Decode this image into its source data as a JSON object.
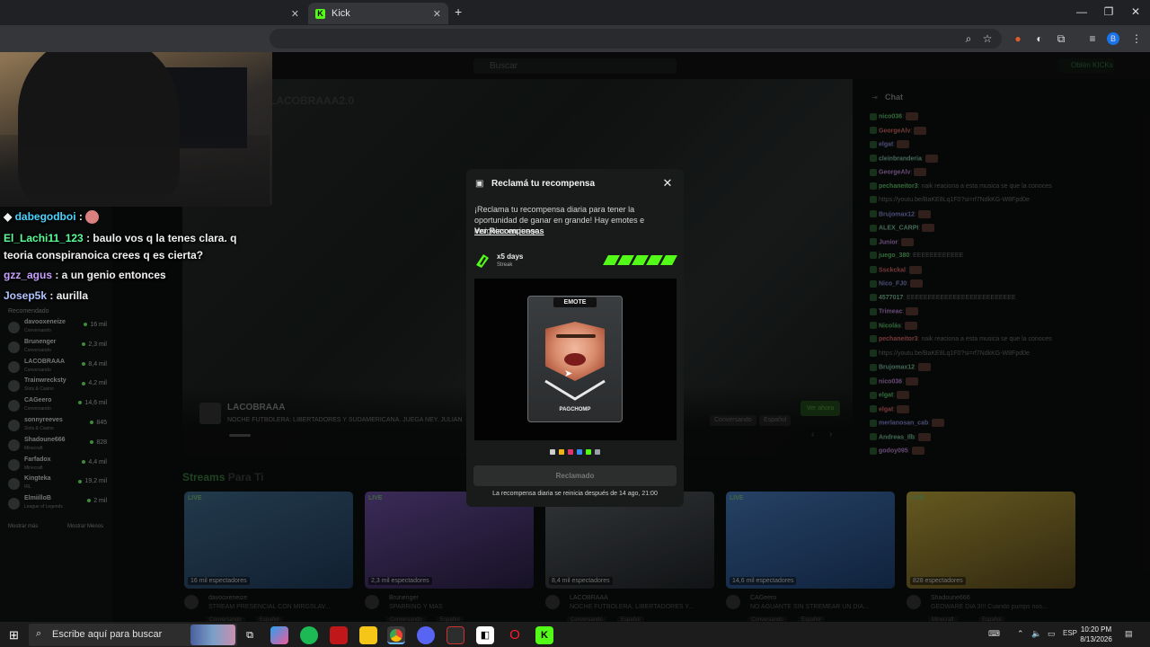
{
  "browser": {
    "tabs": [
      {
        "label": ""
      },
      {
        "label": "Kick"
      }
    ],
    "new_tab": "+"
  },
  "site": {
    "search_placeholder": "Buscar",
    "login_label": "Obtén KICKs",
    "hero": {
      "channel": "LACOBRAAA",
      "description": "NOCHE FUTBOLERA: LIBERTADORES Y SUDAMERICANA. JUEGA NEY. JULIÁN",
      "tag1": "Conversando",
      "tag2": "Español",
      "watch_label": "Ver ahora",
      "watermark": "LACOBRAAA2.0"
    }
  },
  "overlay_chat": [
    {
      "user": "dabegodboi",
      "message": " : "
    },
    {
      "user": "El_Lachi11_123",
      "message": " : baulo vos q la tenes clara. q"
    },
    {
      "user": "",
      "message": "teoria conspiranoica crees q es cierta?"
    },
    {
      "user": "gzz_agus",
      "message": " : a un genio entonces"
    },
    {
      "user": "Josep5k",
      "message": " : aurilla"
    }
  ],
  "sidebar": {
    "heading": "Recomendado",
    "items": [
      {
        "name": "davooxeneize",
        "category": "Conversando",
        "count": "16 mil"
      },
      {
        "name": "Brunenger",
        "category": "Conversando",
        "count": "2,3 mil"
      },
      {
        "name": "LACOBRAAA",
        "category": "Conversando",
        "count": "8,4 mil"
      },
      {
        "name": "Trainwrecksty",
        "category": "Slots & Casino",
        "count": "4,2 mil"
      },
      {
        "name": "CAGeero",
        "category": "Conversando",
        "count": "14,6 mil"
      },
      {
        "name": "sonnyreeves",
        "category": "Slots & Casino",
        "count": "845"
      },
      {
        "name": "Shadoune666",
        "category": "Minecraft",
        "count": "828"
      },
      {
        "name": "Farfadox",
        "category": "Minecraft",
        "count": "4,4 mil"
      },
      {
        "name": "Kingteka",
        "category": "IRL",
        "count": "19,2 mil"
      },
      {
        "name": "ElmiilloB",
        "category": "League of Legends",
        "count": "2 mil"
      }
    ],
    "show_more": "Mostrar más",
    "show_less": "Mostrar Menos"
  },
  "chat": {
    "heading": "Chat",
    "lines": [
      {
        "user": "nico036",
        "text": ":"
      },
      {
        "user": "GeorgeAlv",
        "text": ":"
      },
      {
        "user": "elgat",
        "text": ":"
      },
      {
        "user": "cleinbranderia",
        "text": ":"
      },
      {
        "user": "GeorgeAlv",
        "text": ":"
      },
      {
        "user": "pechaneitor3",
        "text": ": naik reaciona a esta musica se que la conoces"
      },
      {
        "user": "",
        "text": "https://youtu.be/BaKE8Lq1F0?si=rf7NdkKG-W8Fpd0e"
      },
      {
        "user": "Brujomax12",
        "text": ":"
      },
      {
        "user": "ALEX_CARPI",
        "text": ":"
      },
      {
        "user": "Junior",
        "text": ":"
      },
      {
        "user": "juego_380",
        "text": ": EEEEEEEEEEEE"
      },
      {
        "user": "Ssckckal",
        "text": ":"
      },
      {
        "user": "Nico_FJ0",
        "text": ":"
      },
      {
        "user": "4577017",
        "text": ": EEEEEEEEEEEEEEEEEEEEEEEEEE"
      },
      {
        "user": "Trimeac",
        "text": ":"
      },
      {
        "user": "Nicolás",
        "text": ":"
      },
      {
        "user": "pechaneitor3",
        "text": ": naik reaciona a esta musica se que la conoces"
      },
      {
        "user": "",
        "text": "https://youtu.be/BaKE8Lq1F0?si=rf7NdkKG-W8Fpd0e"
      },
      {
        "user": "Brujomax12",
        "text": ":"
      },
      {
        "user": "nico036",
        "text": ":"
      },
      {
        "user": "elgat",
        "text": ":"
      },
      {
        "user": "elgat",
        "text": ":"
      },
      {
        "user": "merlanosan_cab",
        "text": ":"
      },
      {
        "user": "Andreas_Ilb",
        "text": ":"
      },
      {
        "user": "godoy095",
        "text": ":"
      }
    ]
  },
  "streams_for_you": {
    "title_accent": "Streams",
    "title_rest": " Para Ti",
    "cards": [
      {
        "live": "LIVE",
        "views": "16 mil espectadores",
        "channel": "davooxeneize",
        "title": "STREAM PRESENCIAL CON MIRGSLAV...",
        "tags": [
          "Conversando",
          "Español"
        ],
        "color1": "#3f6a8a",
        "color2": "#1e3a5a"
      },
      {
        "live": "LIVE",
        "views": "2,3 mil espectadores",
        "channel": "Brunenger",
        "title": "SPARRING Y MAS",
        "tags": [
          "Conversando",
          "Español"
        ],
        "color1": "#6c4fa0",
        "color2": "#2a2045"
      },
      {
        "live": "LIVE",
        "views": "8,4 mil espectadores",
        "channel": "LACOBRAAA",
        "title": "NOCHE FUTBOLERA: LIBERTADORES Y...",
        "tags": [
          "Conversando",
          "Español"
        ],
        "color1": "#5a5f63",
        "color2": "#1f2327"
      },
      {
        "live": "LIVE",
        "views": "14,6 mil espectadores",
        "channel": "CAGeero",
        "title": "NO AGUANTE SIN STREMEAR UN DIA...",
        "tags": [
          "Conversando",
          "Español"
        ],
        "color1": "#4678b8",
        "color2": "#1d3f6e"
      },
      {
        "live": "LIVE",
        "views": "828 espectadores",
        "channel": "Shadoune666",
        "title": "GEOWARE DIA 3!!! Cuando pumps nos...",
        "tags": [
          "Minecraft",
          "Español"
        ],
        "color1": "#b8a23a",
        "color2": "#5a4a1e"
      }
    ]
  },
  "modal": {
    "title": "Reclamá tu recompensa",
    "body": "¡Reclama tu recompensa diaria para tener la oportunidad de ganar en grande! Hay emotes e insignias en juego.",
    "link": "Ver Recompensas",
    "streak_days": "x5 days",
    "streak_label": "Streak",
    "streak_filled": 5,
    "streak_total": 5,
    "reward_type": "EMOTE",
    "reward_name": "PAGCHOMP",
    "claim_label": "Reclamado",
    "reset_text": "La recompensa diaria se reinicia después de 14 ago, 21:00",
    "dot_colors": [
      "#cfcfcf",
      "#f2b21a",
      "#e0356a",
      "#3b8bf2",
      "#53fc18",
      "#9aa0a6"
    ]
  },
  "taskbar": {
    "search_placeholder": "Escribe aquí para buscar",
    "time": "10:20 PM",
    "date": "8/13/2026",
    "lang": "ESP"
  }
}
